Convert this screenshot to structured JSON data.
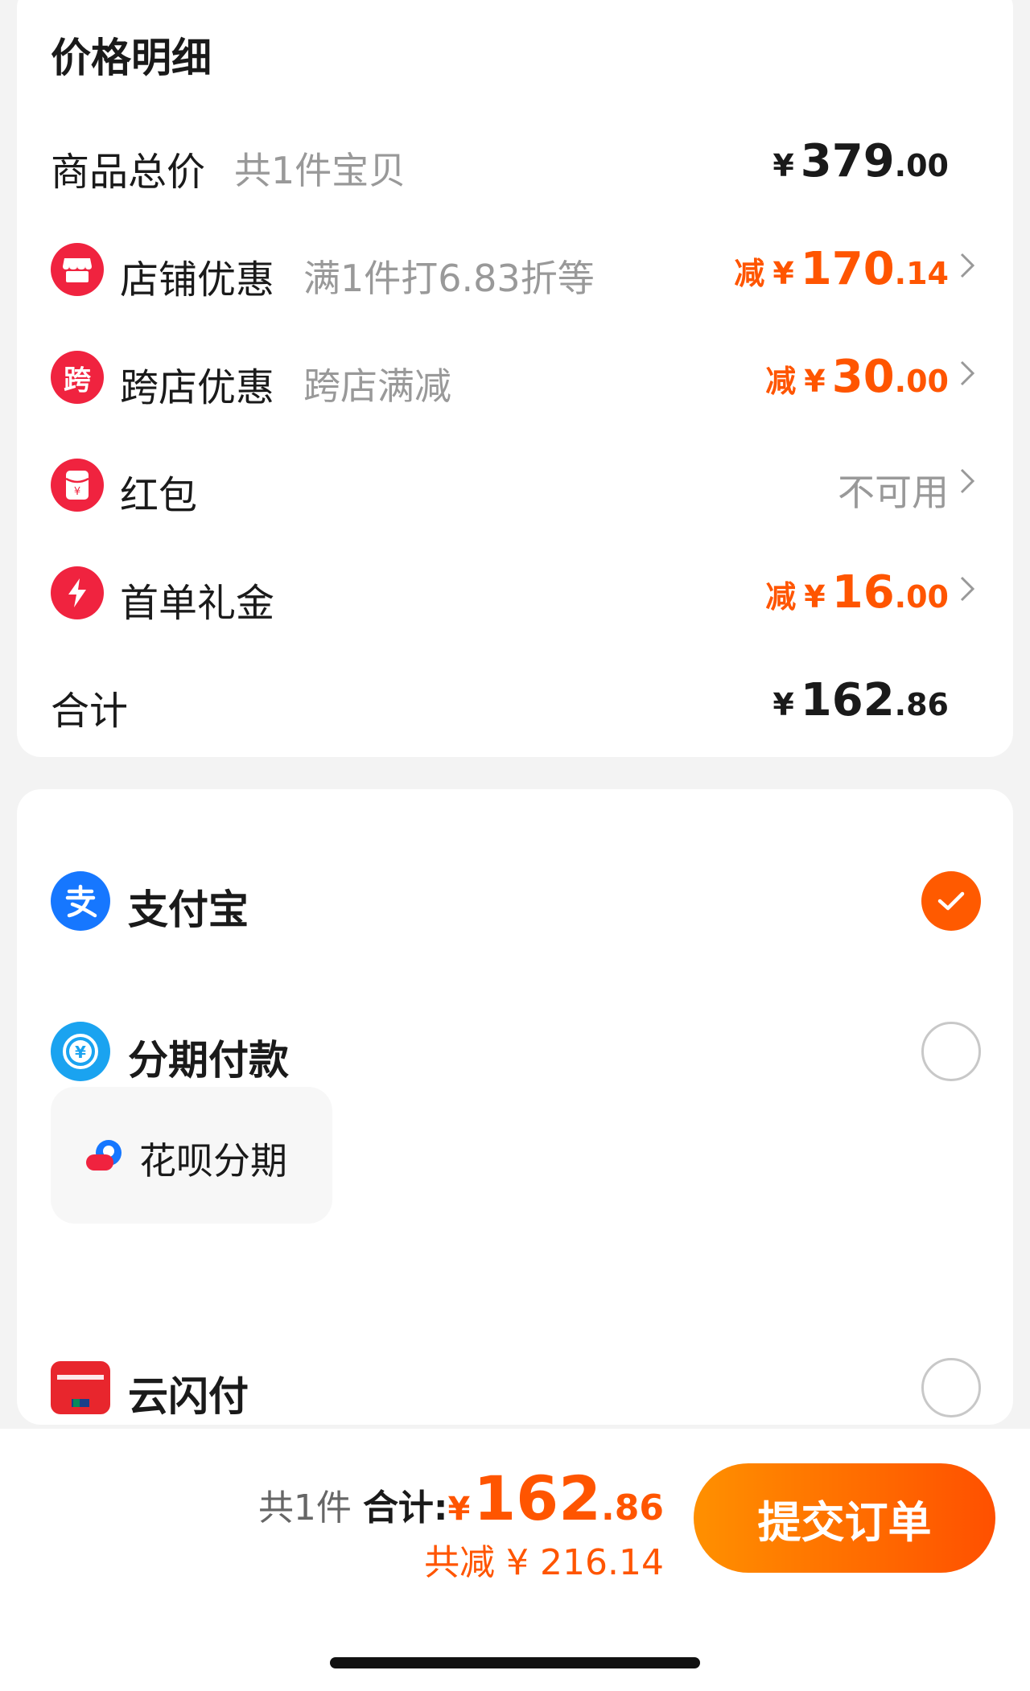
{
  "price_detail": {
    "title": "价格明细",
    "goods_total": {
      "label": "商品总价",
      "sub": "共1件宝贝",
      "currency": "¥",
      "amount_int": "379",
      "amount_dec": ".00"
    },
    "store_discount": {
      "label": "店铺优惠",
      "sub": "满1件打6.83折等",
      "prefix": "减",
      "currency": "¥",
      "amount_int": "170",
      "amount_dec": ".14",
      "icon": "store-icon"
    },
    "cross_store": {
      "label": "跨店优惠",
      "sub": "跨店满减",
      "prefix": "减",
      "currency": "¥",
      "amount_int": "30",
      "amount_dec": ".00",
      "icon": "cross-store-icon",
      "icon_char": "跨"
    },
    "red_packet": {
      "label": "红包",
      "status": "不可用",
      "icon": "red-packet-icon"
    },
    "first_order": {
      "label": "首单礼金",
      "prefix": "减",
      "currency": "¥",
      "amount_int": "16",
      "amount_dec": ".00",
      "icon": "lightning-icon"
    },
    "total": {
      "label": "合计",
      "currency": "¥",
      "amount_int": "162",
      "amount_dec": ".86"
    }
  },
  "payment": {
    "alipay": {
      "label": "支付宝",
      "icon": "alipay-icon",
      "selected": true
    },
    "installment": {
      "label": "分期付款",
      "icon": "installment-icon",
      "selected": false
    },
    "huabei": {
      "label": "花呗分期",
      "icon": "huabei-icon"
    },
    "unionpay": {
      "label": "云闪付",
      "icon": "unionpay-icon",
      "selected": false
    }
  },
  "bottom_bar": {
    "count": "共1件",
    "total_label": "合计:",
    "currency": "¥",
    "total_int": "162",
    "total_dec": ".86",
    "saved": "共减 ¥ 216.14",
    "submit": "提交订单"
  },
  "colors": {
    "accent": "#ff5500",
    "red_icon": "#f0233f",
    "alipay_blue": "#1677ff",
    "background": "#f3f3f3"
  }
}
